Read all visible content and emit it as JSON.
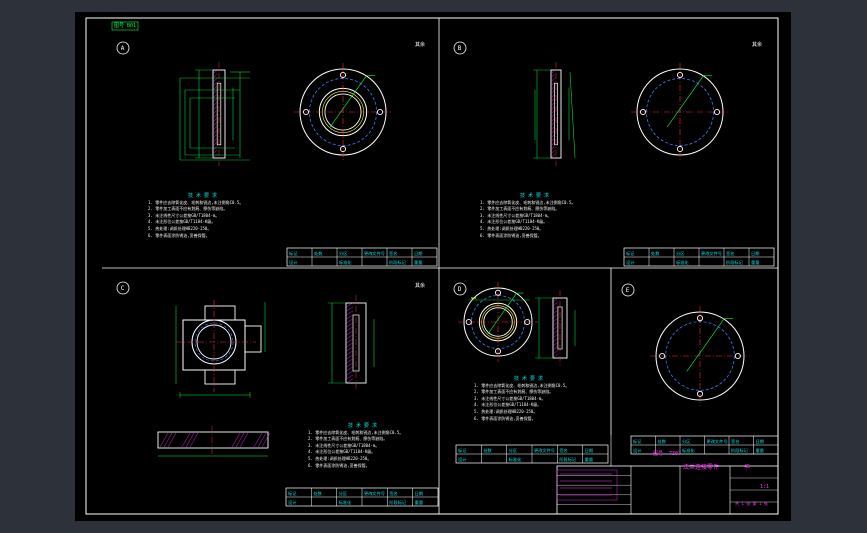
{
  "drawing": {
    "colors": {
      "viewport_bg": "#2c313a",
      "sheet_bg": "#000000",
      "frame": "#ffffff",
      "outline": "#ffffff",
      "center": "#ff2a2a",
      "dim": "#00ff40",
      "hidden": "#3a7bff",
      "cyan": "#00e0e0",
      "yellow": "#ffff00",
      "magenta": "#ff33ff"
    },
    "top_tag": "图号 B01",
    "views": {
      "A": {
        "letter": "A",
        "roughness": "其余"
      },
      "B": {
        "letter": "B",
        "roughness": "其余"
      },
      "C": {
        "letter": "C",
        "roughness": "其余"
      },
      "D": {
        "letter": "D",
        "roughness": ""
      },
      "E": {
        "letter": "E",
        "roughness": ""
      }
    },
    "notes_heading": "技 术 要 求",
    "notes": [
      "1. 零件应去除氧化皮、毛刺和锐边,未注倒角C0.5。",
      "2. 零件加工表面不应有划痕、擦伤等缺陷。",
      "3. 未注线性尺寸公差按GB/T1804-m。",
      "4. 未注形位公差按GB/T1184-K级。",
      "5. 热处理:调质处理HB220-250。",
      "6. 零件表面涂防锈油,妥善保管。"
    ],
    "table_row1": [
      "标记",
      "处数",
      "分区",
      "更改文件号",
      "签名",
      "日期"
    ],
    "table_row2": [
      "设计",
      "",
      "标准化",
      "",
      "阶段标记",
      "重量"
    ],
    "title_block": {
      "title": "法兰连接零件",
      "drawing_no": "图号 -7307",
      "material": "45",
      "scale": "1:1",
      "sheet": "共 1 张 第 1 张"
    }
  }
}
